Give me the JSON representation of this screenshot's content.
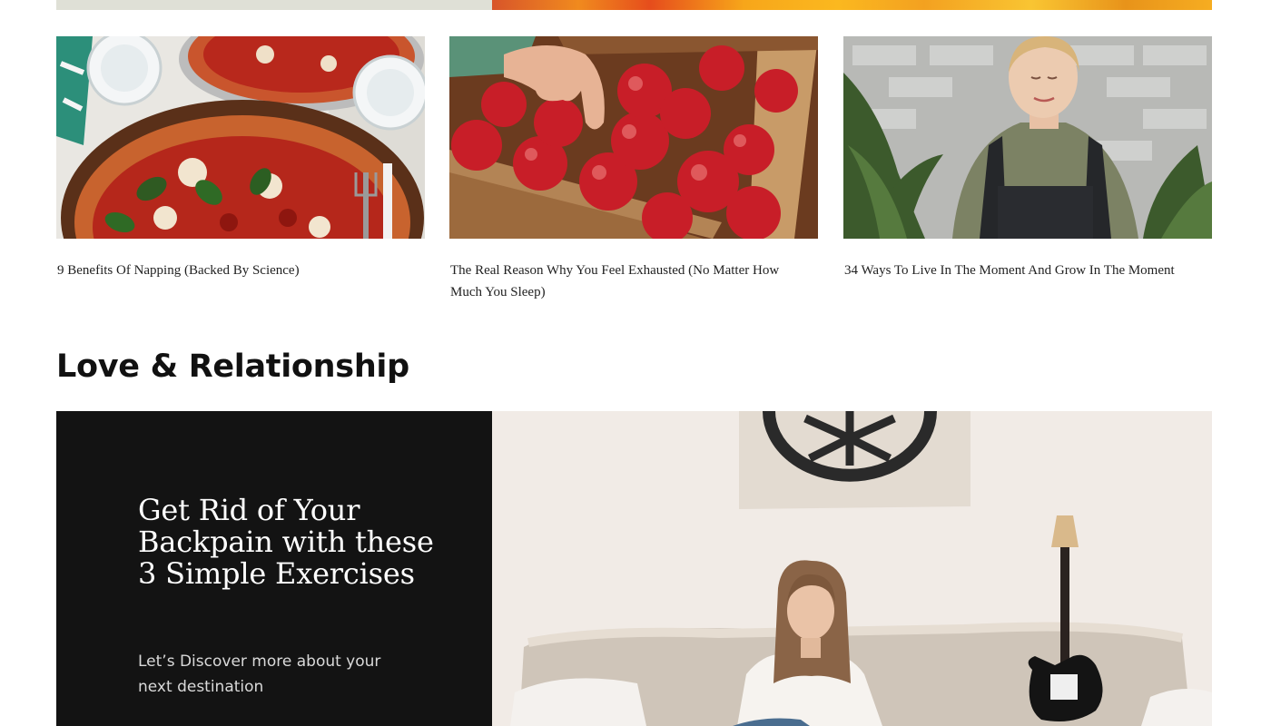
{
  "articles": [
    {
      "title": "9 Benefits Of Napping (Backed By Science)",
      "image": "pizza-photo"
    },
    {
      "title": "The Real Reason Why You Feel Exhausted (No Matter How Much You Sleep)",
      "image": "apples-crate-photo"
    },
    {
      "title": "34 Ways To Live In The Moment And Grow In The Moment",
      "image": "woman-in-overalls-photo"
    }
  ],
  "section": {
    "title": "Love & Relationship"
  },
  "feature": {
    "title": "Get Rid of  Your Backpain with these 3 Simple Exercises",
    "subtitle": "Let’s Discover more about your next destination",
    "image": "woman-on-sofa-with-guitar-photo"
  },
  "colors": {
    "feature_panel": "#131313",
    "top_strip_left": "#dfe0d6",
    "top_strip_right": "#f3a120"
  }
}
